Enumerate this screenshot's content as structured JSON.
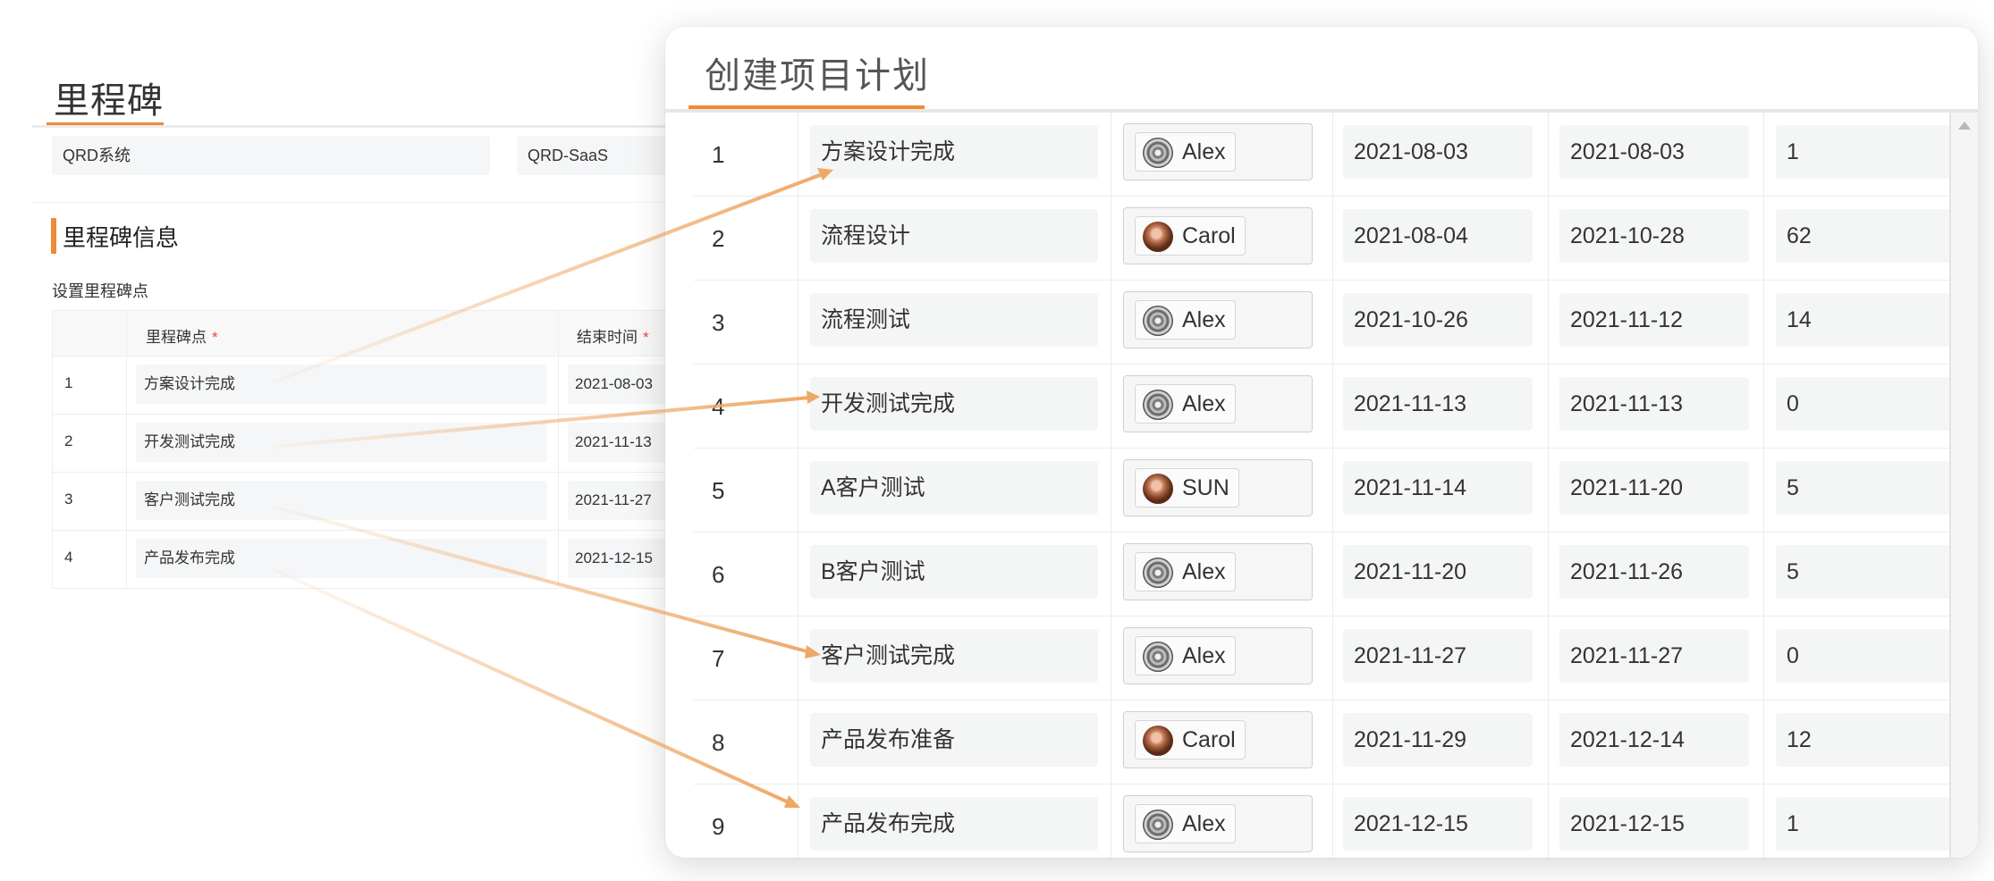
{
  "milestone_page": {
    "title": "里程碑",
    "project_name": "QRD系统",
    "project_code": "QRD-SaaS",
    "section_title": "里程碑信息",
    "set_label": "设置里程碑点",
    "columns": {
      "milestone": "里程碑点",
      "end_time": "结束时间",
      "required_mark": "*"
    },
    "rows": [
      {
        "index": "1",
        "name": "方案设计完成",
        "end": "2021-08-03"
      },
      {
        "index": "2",
        "name": "开发测试完成",
        "end": "2021-11-13"
      },
      {
        "index": "3",
        "name": "客户测试完成",
        "end": "2021-11-27"
      },
      {
        "index": "4",
        "name": "产品发布完成",
        "end": "2021-12-15"
      }
    ]
  },
  "plan_panel": {
    "title": "创建项目计划",
    "rows": [
      {
        "index": "1",
        "task": "方案设计完成",
        "owner": "Alex",
        "avatar": "alex-avatar-icon",
        "start": "2021-08-03",
        "end": "2021-08-03",
        "days": "1"
      },
      {
        "index": "2",
        "task": "流程设计",
        "owner": "Carol",
        "avatar": "carol-avatar-icon",
        "start": "2021-08-04",
        "end": "2021-10-28",
        "days": "62"
      },
      {
        "index": "3",
        "task": "流程测试",
        "owner": "Alex",
        "avatar": "alex-avatar-icon",
        "start": "2021-10-26",
        "end": "2021-11-12",
        "days": "14"
      },
      {
        "index": "4",
        "task": "开发测试完成",
        "owner": "Alex",
        "avatar": "alex-avatar-icon",
        "start": "2021-11-13",
        "end": "2021-11-13",
        "days": "0"
      },
      {
        "index": "5",
        "task": "A客户测试",
        "owner": "SUN",
        "avatar": "sun-avatar-icon",
        "start": "2021-11-14",
        "end": "2021-11-20",
        "days": "5"
      },
      {
        "index": "6",
        "task": "B客户测试",
        "owner": "Alex",
        "avatar": "alex-avatar-icon",
        "start": "2021-11-20",
        "end": "2021-11-26",
        "days": "5"
      },
      {
        "index": "7",
        "task": "客户测试完成",
        "owner": "Alex",
        "avatar": "alex-avatar-icon",
        "start": "2021-11-27",
        "end": "2021-11-27",
        "days": "0"
      },
      {
        "index": "8",
        "task": "产品发布准备",
        "owner": "Carol",
        "avatar": "carol-avatar-icon",
        "start": "2021-11-29",
        "end": "2021-12-14",
        "days": "12"
      },
      {
        "index": "9",
        "task": "产品发布完成",
        "owner": "Alex",
        "avatar": "alex-avatar-icon",
        "start": "2021-12-15",
        "end": "2021-12-15",
        "days": "1"
      }
    ]
  },
  "colors": {
    "accent": "#f08a36",
    "arrow": "#eea866",
    "required": "#e8453c"
  }
}
